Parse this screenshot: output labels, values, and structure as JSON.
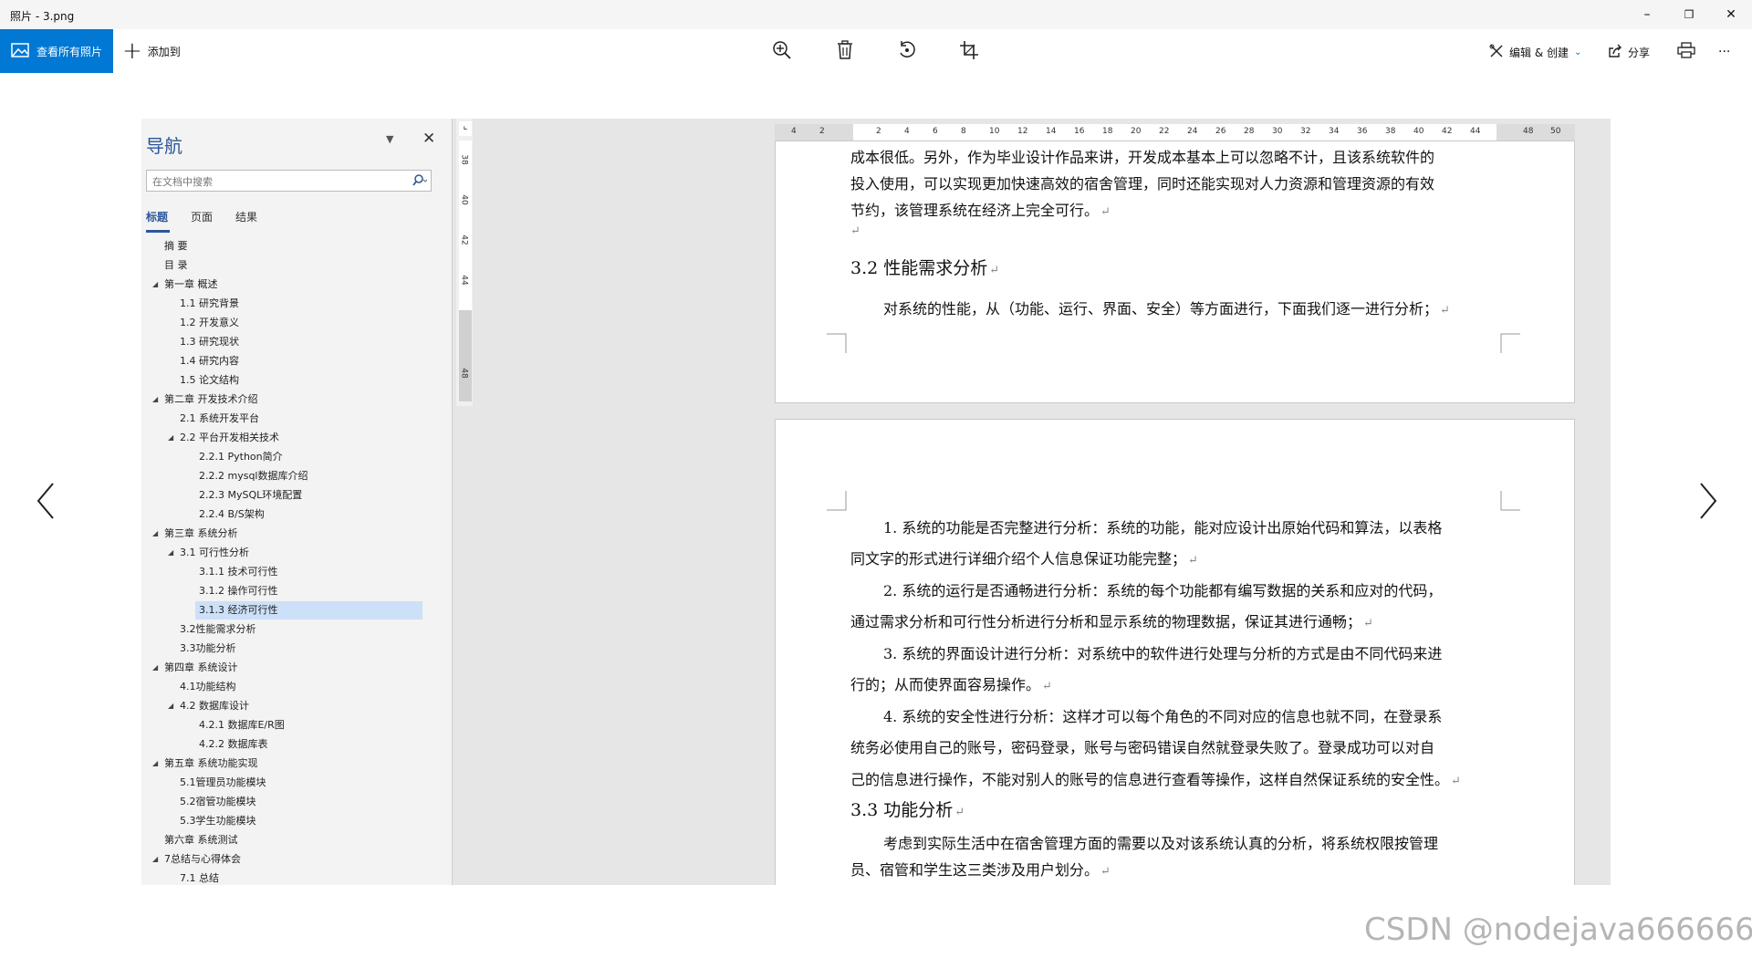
{
  "window": {
    "title": "照片 - 3.png",
    "minimize": "–",
    "restore": "❐",
    "close": "✕"
  },
  "toolbar": {
    "view_all_label": "查看所有照片",
    "add_to_label": "添加到",
    "edit_create_label": "编辑 & 创建",
    "share_label": "分享",
    "more_label": "···"
  },
  "nav_pane": {
    "title": "导航",
    "search_placeholder": "在文档中搜索",
    "tabs": [
      "标题",
      "页面",
      "结果"
    ],
    "items": [
      {
        "label": "摘  要",
        "level": 1,
        "arrow": ""
      },
      {
        "label": "目  录",
        "level": 1,
        "arrow": ""
      },
      {
        "label": "第一章 概述",
        "level": 1,
        "arrow": "◢"
      },
      {
        "label": "1.1 研究背景",
        "level": 2,
        "arrow": ""
      },
      {
        "label": "1.2 开发意义",
        "level": 2,
        "arrow": ""
      },
      {
        "label": "1.3 研究现状",
        "level": 2,
        "arrow": ""
      },
      {
        "label": "1.4 研究内容",
        "level": 2,
        "arrow": ""
      },
      {
        "label": "1.5 论文结构",
        "level": 2,
        "arrow": ""
      },
      {
        "label": " 第二章 开发技术介绍",
        "level": 1,
        "arrow": "◢"
      },
      {
        "label": "2.1 系统开发平台",
        "level": 2,
        "arrow": ""
      },
      {
        "label": "2.2 平台开发相关技术",
        "level": 2,
        "arrow": "◢"
      },
      {
        "label": "2.2.1  Python简介",
        "level": 3,
        "arrow": ""
      },
      {
        "label": "2.2.2  mysql数据库介绍",
        "level": 3,
        "arrow": ""
      },
      {
        "label": "2.2.3  MySQL环境配置",
        "level": 3,
        "arrow": ""
      },
      {
        "label": "2.2.4  B/S架构",
        "level": 3,
        "arrow": ""
      },
      {
        "label": "第三章 系统分析",
        "level": 1,
        "arrow": "◢"
      },
      {
        "label": "3.1 可行性分析",
        "level": 2,
        "arrow": "◢"
      },
      {
        "label": "3.1.1 技术可行性",
        "level": 3,
        "arrow": ""
      },
      {
        "label": "3.1.2 操作可行性",
        "level": 3,
        "arrow": ""
      },
      {
        "label": "3.1.3 经济可行性",
        "level": 3,
        "arrow": "",
        "selected": true
      },
      {
        "label": "3.2性能需求分析",
        "level": 2,
        "arrow": ""
      },
      {
        "label": "3.3功能分析",
        "level": 2,
        "arrow": ""
      },
      {
        "label": "第四章 系统设计",
        "level": 1,
        "arrow": "◢"
      },
      {
        "label": "4.1功能结构",
        "level": 2,
        "arrow": ""
      },
      {
        "label": "4.2 数据库设计",
        "level": 2,
        "arrow": "◢"
      },
      {
        "label": "4.2.1 数据库E/R图",
        "level": 3,
        "arrow": ""
      },
      {
        "label": "4.2.2 数据库表",
        "level": 3,
        "arrow": ""
      },
      {
        "label": "第五章 系统功能实现",
        "level": 1,
        "arrow": "◢"
      },
      {
        "label": "5.1管理员功能模块",
        "level": 2,
        "arrow": ""
      },
      {
        "label": "5.2宿管功能模块",
        "level": 2,
        "arrow": ""
      },
      {
        "label": "5.3学生功能模块",
        "level": 2,
        "arrow": ""
      },
      {
        "label": "第六章 系统测试",
        "level": 1,
        "arrow": ""
      },
      {
        "label": "7总结与心得体会",
        "level": 1,
        "arrow": "◢"
      },
      {
        "label": "7.1 总结",
        "level": 2,
        "arrow": ""
      }
    ]
  },
  "rulers": {
    "top_numbers": [
      "4",
      "2",
      "2",
      "4",
      "6",
      "8",
      "10",
      "12",
      "14",
      "16",
      "18",
      "20",
      "22",
      "24",
      "26",
      "28",
      "30",
      "32",
      "34",
      "36",
      "38",
      "40",
      "42",
      "44",
      "48",
      "50"
    ],
    "left_numbers": [
      "38",
      "40",
      "42",
      "44",
      "48"
    ]
  },
  "document": {
    "page1": {
      "lines": [
        "成本很低。另外，作为毕业设计作品来讲，开发成本基本上可以忽略不计，且该系统软件的",
        "投入使用，可以实现更加快速高效的宿舍管理，同时还能实现对人力资源和管理资源的有效",
        "节约，该管理系统在经济上完全可行。"
      ],
      "heading": "3.2 性能需求分析",
      "para": "对系统的性能，从（功能、运行、界面、安全）等方面进行，下面我们逐一进行分析；"
    },
    "page2": {
      "lines": [
        "1.  系统的功能是否完整进行分析：系统的功能，能对应设计出原始代码和算法，以表格",
        "同文字的形式进行详细介绍个人信息保证功能完整；",
        "2.  系统的运行是否通畅进行分析：系统的每个功能都有编写数据的关系和应对的代码，",
        "通过需求分析和可行性分析进行分析和显示系统的物理数据，保证其进行通畅；",
        "3.  系统的界面设计进行分析：对系统中的软件进行处理与分析的方式是由不同代码来进",
        "行的；从而使界面容易操作。",
        "4.  系统的安全性进行分析：这样才可以每个角色的不同对应的信息也就不同，在登录系",
        "统务必使用自己的账号，密码登录，账号与密码错误自然就登录失败了。登录成功可以对自",
        "己的信息进行操作，不能对别人的账号的信息进行查看等操作，这样自然保证系统的安全性。"
      ],
      "heading": "3.3 功能分析",
      "para_lines": [
        "考虑到实际生活中在宿舍管理方面的需要以及对该系统认真的分析，将系统权限按管理",
        "员、宿管和学生这三类涉及用户划分。"
      ]
    }
  },
  "watermark": "CSDN @nodejava666666"
}
